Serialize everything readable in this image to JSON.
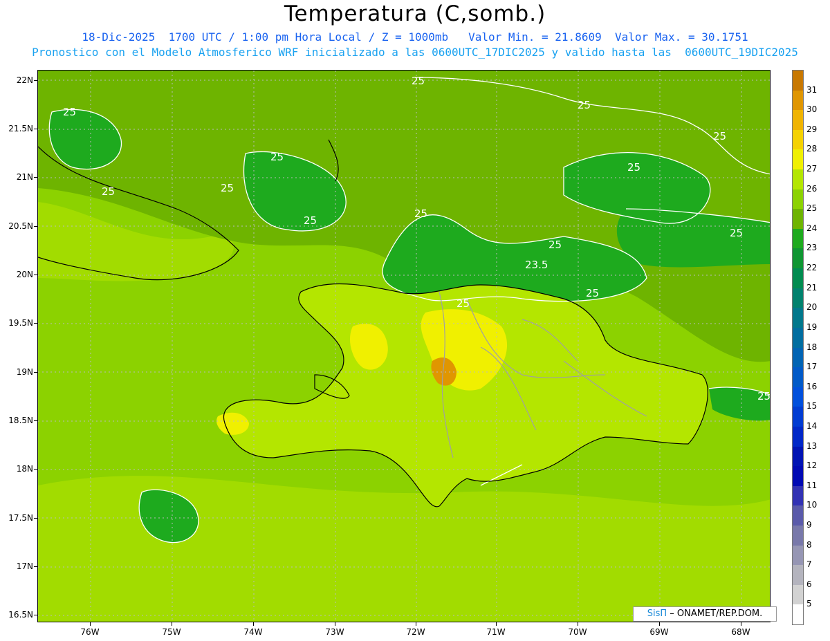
{
  "header": {
    "title": "Temperatura (C,somb.)",
    "line1": "18-Dic-2025  1700 UTC / 1:00 pm Hora Local / Z = 1000mb   Valor Min. = 21.8609  Valor Max. = 30.1751",
    "line2": "Pronostico con el Modelo Atmosferico WRF inicializado a las 0600UTC_17DIC2025 y valido hasta las  0600UTC_19DIC2025"
  },
  "axes": {
    "lat_labels": [
      "22N",
      "21.5N",
      "21N",
      "20.5N",
      "20N",
      "19.5N",
      "19N",
      "18.5N",
      "18N",
      "17.5N",
      "17N",
      "16.5N"
    ],
    "lon_labels": [
      "76W",
      "75W",
      "74W",
      "73W",
      "72W",
      "71W",
      "70W",
      "69W",
      "68W"
    ]
  },
  "colorbar": {
    "labels": [
      "31",
      "30",
      "29",
      "28",
      "27",
      "26",
      "25",
      "24",
      "23",
      "22",
      "21",
      "20",
      "19",
      "18",
      "17",
      "16",
      "15",
      "14",
      "13",
      "12",
      "11",
      "10",
      "9",
      "8",
      "7",
      "6",
      "5"
    ],
    "colors": [
      "#c87800",
      "#e09600",
      "#f0b400",
      "#f5d200",
      "#f0f000",
      "#b4e600",
      "#8cd200",
      "#6eb400",
      "#1eaa1e",
      "#0f9632",
      "#008c50",
      "#00826e",
      "#00788c",
      "#006ea0",
      "#0064b4",
      "#005ac8",
      "#0050dc",
      "#003cd2",
      "#0028c8",
      "#0014b4",
      "#000ab4",
      "#3232b4",
      "#5a5aaa",
      "#7878aa",
      "#9696b4",
      "#b4b4be",
      "#d2d2d2",
      "#ffffff"
    ]
  },
  "map_labels": {
    "contours": [
      "25",
      "25",
      "25",
      "25",
      "25",
      "25",
      "25",
      "25",
      "25",
      "25",
      "25",
      "25",
      "25",
      "25",
      "25",
      "23.5"
    ]
  },
  "credit": {
    "brand": "SisΠ",
    "text": "– ONAMET/REP.DOM."
  }
}
